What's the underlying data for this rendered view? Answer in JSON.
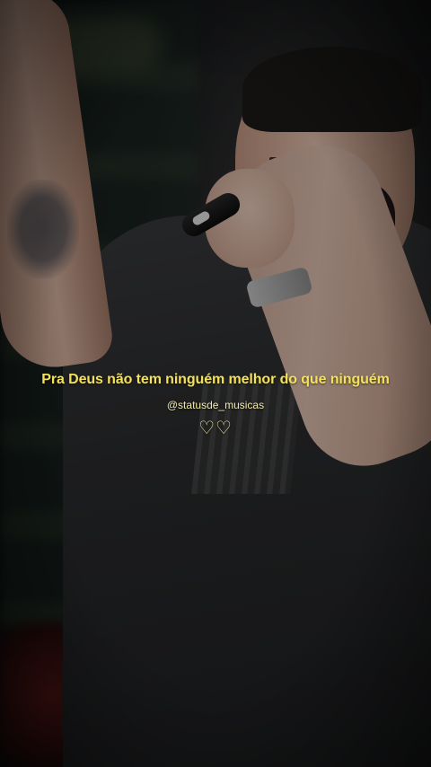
{
  "caption": {
    "lyric": "Pra Deus não tem ninguém melhor do que ninguém",
    "handle": "@statusde_musicas",
    "hearts": "♡♡",
    "lyric_color": "#f3e15a",
    "handle_color": "#f1e9a8"
  }
}
